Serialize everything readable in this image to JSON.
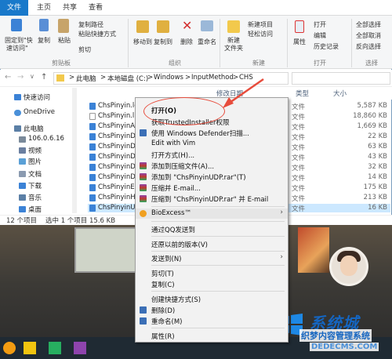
{
  "ribbon_tabs": {
    "file": "文件",
    "home": "主页",
    "share": "共享",
    "view": "查看"
  },
  "ribbon": {
    "pin": "固定到\"快\n速访问\"",
    "pin_l1": "固定到\"快",
    "pin_l2": "速访问\"",
    "copy": "复制",
    "paste": "粘贴",
    "copy_path": "复制路径",
    "paste_shortcut": "粘贴快捷方式",
    "cut": "剪切",
    "clipboard_group": "剪贴板",
    "move_to": "移动到",
    "copy_to": "复制到",
    "delete": "删除",
    "rename": "重命名",
    "organize_group": "组织",
    "new_folder_l1": "新建",
    "new_folder_l2": "文件夹",
    "new_item": "新建项目",
    "easy_access": "轻松访问",
    "new_group": "新建",
    "properties": "属性",
    "open": "打开",
    "edit": "编辑",
    "history": "历史记录",
    "open_group": "打开",
    "select_all": "全部选择",
    "select_none": "全部取消",
    "invert_selection": "反向选择",
    "select_group": "选择"
  },
  "address": {
    "crumbs": [
      "此电脑",
      "本地磁盘 (C:)",
      "Windows",
      "InputMethod",
      "CHS"
    ],
    "sep": ">"
  },
  "nav": {
    "quick_access": "快速访问",
    "onedrive": "OneDrive",
    "this_pc": "此电脑",
    "items": [
      "106.0.6.16",
      "视频",
      "图片",
      "文档",
      "下载",
      "音乐",
      "桌面"
    ]
  },
  "columns": {
    "modified": "修改日期",
    "type": "类型",
    "size": "大小"
  },
  "files": [
    {
      "name": "ChsPinyin.lex",
      "type": "文件",
      "size": "5,587 KB"
    },
    {
      "name": "ChsPinyin.lm",
      "type": "文件",
      "size": "18,860 KB"
    },
    {
      "name": "ChsPinyinAP",
      "type": "文件",
      "size": "1,669 KB"
    },
    {
      "name": "ChsPinyinDM",
      "type": "文件",
      "size": "22 KB"
    },
    {
      "name": "ChsPinyinDM",
      "type": "文件",
      "size": "63 KB"
    },
    {
      "name": "ChsPinyinDM",
      "type": "文件",
      "size": "43 KB"
    },
    {
      "name": "ChsPinyinDM",
      "type": "文件",
      "size": "32 KB"
    },
    {
      "name": "ChsPinyinDM",
      "type": "文件",
      "size": "14 KB"
    },
    {
      "name": "ChsPinyinEU",
      "type": "文件",
      "size": "175 KB"
    },
    {
      "name": "ChsPinyinHA",
      "type": "文件",
      "size": "213 KB"
    },
    {
      "name": "ChsPinyinUD",
      "type": "文件",
      "size": "16 KB"
    }
  ],
  "status": {
    "count": "12 个项目",
    "selected": "选中 1 个项目  15.6 KB"
  },
  "menu": {
    "open": "打开(O)",
    "trusted": "获取TrustedInstaller权限",
    "defender": "使用 Windows Defender扫描...",
    "vim": "Edit with Vim",
    "open_with": "打开方式(H)...",
    "add_archive": "添加到压缩文件(A)...",
    "add_rar": "添加到 \"ChsPinyinUDP.rar\"(T)",
    "compress_email": "压缩并 E-mail...",
    "compress_rar_email": "压缩到 \"ChsPinyinUDP.rar\" 并 E-mail",
    "bioexcess": "BioExcess™",
    "qq_send": "通过QQ发送到",
    "restore": "还原以前的版本(V)",
    "send_to": "发送到(N)",
    "cut": "剪切(T)",
    "copy": "复制(C)",
    "shortcut": "创建快捷方式(S)",
    "delete": "删除(D)",
    "rename": "重命名(M)",
    "properties": "属性(R)"
  },
  "watermark": {
    "line1": "系统城",
    "line2": "织梦内容管理系统",
    "line3": "DEDECMS.COM"
  },
  "colors": {
    "accent": "#1979ca",
    "highlight": "#e74c3c",
    "selection": "#cce8ff",
    "watermark": "#1565c0"
  }
}
